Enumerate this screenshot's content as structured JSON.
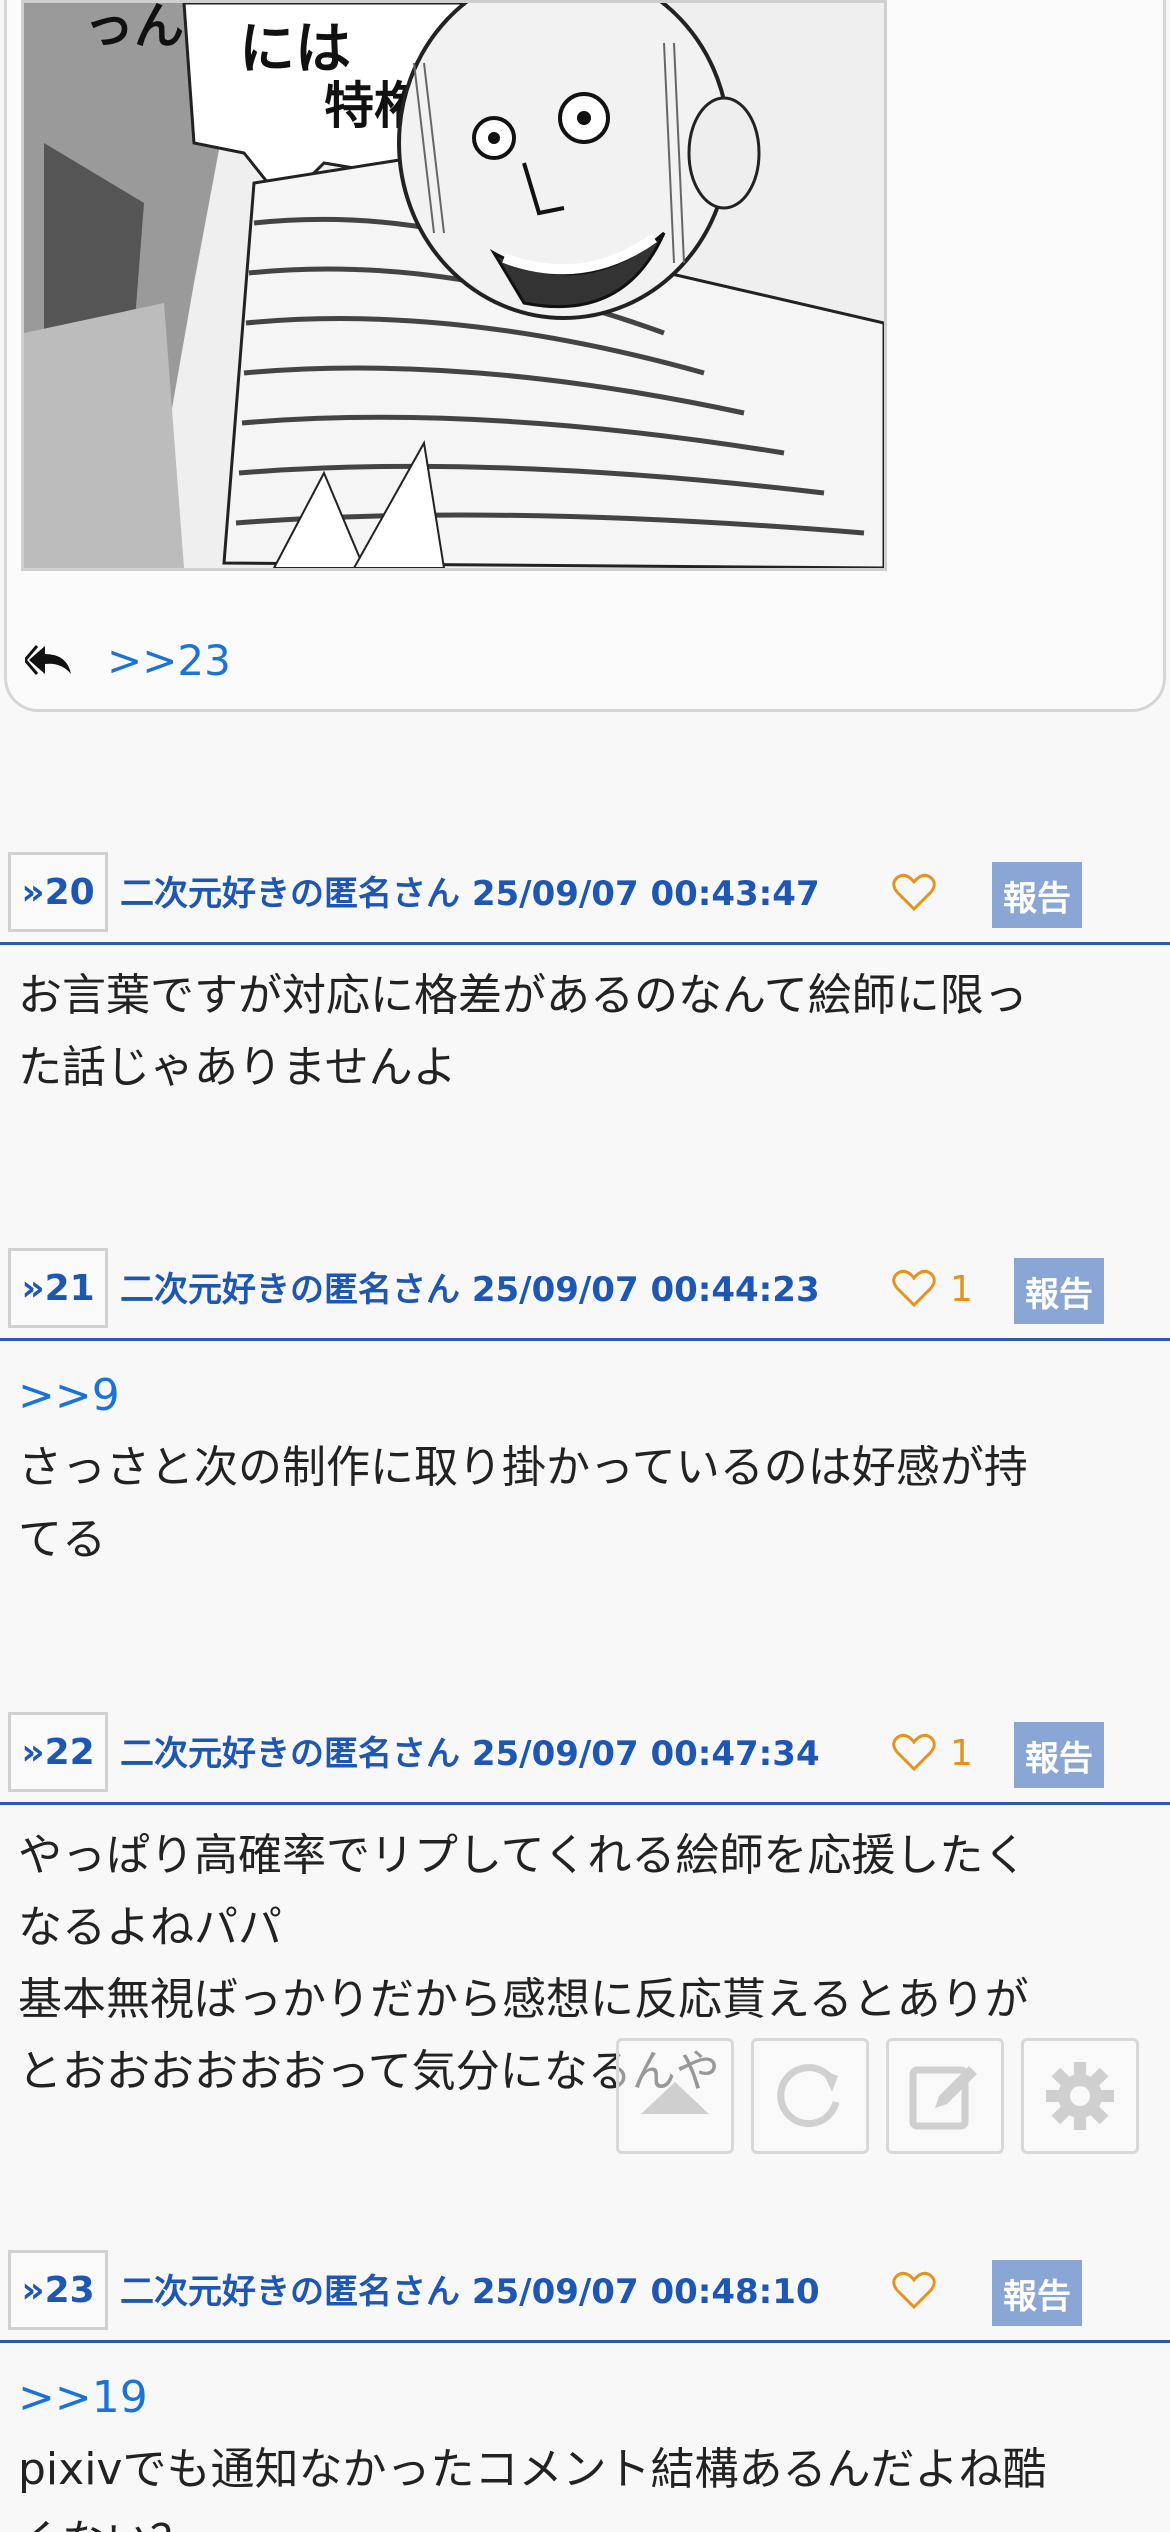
{
  "top_card": {
    "image_alt": "manga panel",
    "manga_text": [
      "には",
      "特権",
      "っん"
    ],
    "reply_anchor": ">>23"
  },
  "posts": [
    {
      "num": "»20",
      "name": "二次元好きの匿名さん",
      "date": "25/09/07 00:43:47",
      "likes": "",
      "report_label": "報告",
      "body_anchor": "",
      "body_lines": [
        "お言葉ですが対応に格差があるのなんて絵師に限っ",
        "た話じゃありませんよ"
      ]
    },
    {
      "num": "»21",
      "name": "二次元好きの匿名さん",
      "date": "25/09/07 00:44:23",
      "likes": "1",
      "report_label": "報告",
      "body_anchor": ">>9",
      "body_lines": [
        "さっさと次の制作に取り掛かっているのは好感が持",
        "てる"
      ]
    },
    {
      "num": "»22",
      "name": "二次元好きの匿名さん",
      "date": "25/09/07 00:47:34",
      "likes": "1",
      "report_label": "報告",
      "body_anchor": "",
      "body_lines": [
        "やっぱり高確率でリプしてくれる絵師を応援したく",
        "なるよねパパ",
        "基本無視ばっかりだから感想に反応貰えるとありが",
        "とおおおおおおって気分になるんや"
      ]
    },
    {
      "num": "»23",
      "name": "二次元好きの匿名さん",
      "date": "25/09/07 00:48:10",
      "likes": "",
      "report_label": "報告",
      "body_anchor": ">>19",
      "body_lines": [
        "pixivでも通知なかったコメント結構あるんだよね酷",
        "くない？"
      ]
    }
  ],
  "toolbar": {
    "icons": [
      "scroll-top-icon",
      "reload-icon",
      "compose-icon",
      "settings-icon"
    ]
  },
  "colors": {
    "link": "#1a73d9",
    "meta": "#1e56b4",
    "like": "#e6931e",
    "report_bg": "#8aa6d4",
    "rule": "#2c5aa8"
  }
}
